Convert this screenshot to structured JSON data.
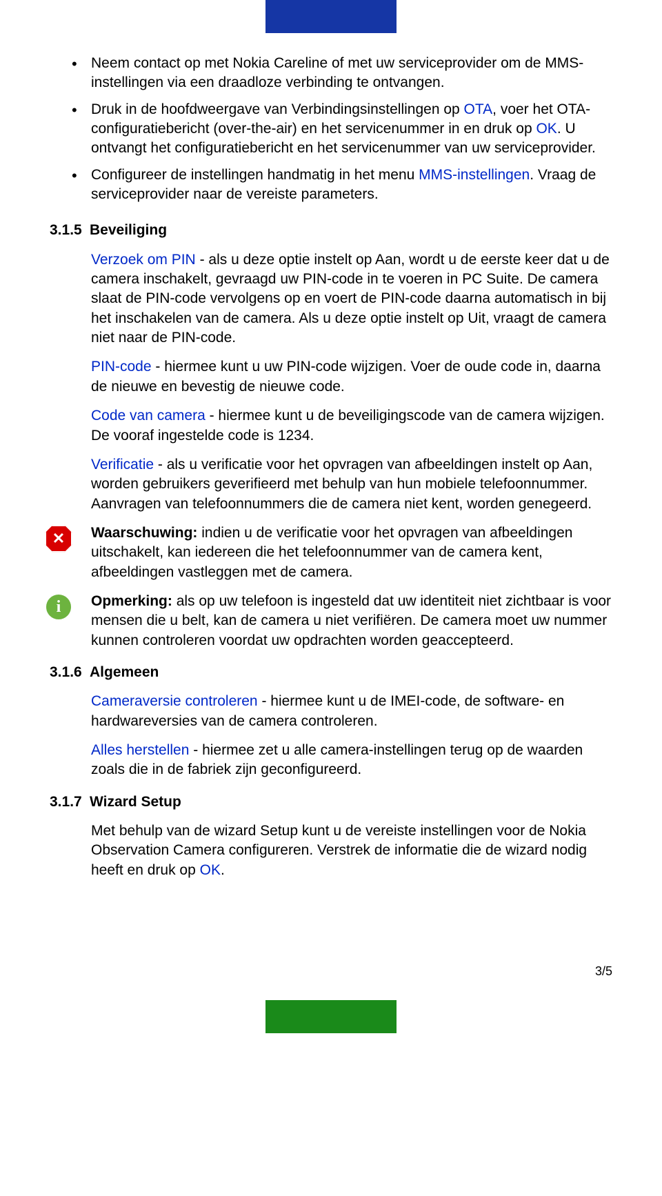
{
  "bullets": [
    {
      "text_before": "Neem contact op met Nokia Careline of met uw serviceprovider om de MMS-instellingen via een draadloze verbinding te ontvangen."
    },
    {
      "text_before": "Druk in de hoofdweergave van Verbindingsinstellingen op ",
      "blue1": "OTA",
      "mid1": ", voer het OTA-configuratiebericht (over-the-air) en het servicenummer in en druk op ",
      "blue2": "OK",
      "mid2": ". U ontvangt het configuratiebericht en het servicenummer van uw serviceprovider."
    },
    {
      "text_before": "Configureer de instellingen handmatig in het menu ",
      "blue1": "MMS-instellingen",
      "mid1": ". Vraag de serviceprovider naar de vereiste parameters."
    }
  ],
  "s315": {
    "num": "3.1.5",
    "title": "Beveiliging",
    "p1_blue": "Verzoek om PIN",
    "p1_rest": " - als u deze optie instelt op Aan, wordt u de eerste keer dat u de camera inschakelt, gevraagd uw PIN-code in te voeren in PC Suite. De camera slaat de PIN-code vervolgens op en voert de PIN-code daarna automatisch in bij het inschakelen van de camera. Als u deze optie instelt op Uit, vraagt de camera niet naar de PIN-code.",
    "p2_blue": "PIN-code",
    "p2_rest": " - hiermee kunt u uw PIN-code wijzigen. Voer de oude code in, daarna de nieuwe en bevestig de nieuwe code.",
    "p3_blue": "Code van camera",
    "p3_rest": " - hiermee kunt u de beveiligingscode van de camera wijzigen. De vooraf ingestelde code is 1234.",
    "p4_blue": "Verificatie",
    "p4_rest": " - als u verificatie voor het opvragen van afbeeldingen instelt op Aan, worden gebruikers geverifieerd met behulp van hun mobiele telefoonnummer. Aanvragen van telefoonnummers die de camera niet kent, worden genegeerd.",
    "warn_label": "Waarschuwing:",
    "warn_text": " indien u de verificatie voor het opvragen van afbeeldingen uitschakelt, kan iedereen die het telefoonnummer van de camera kent, afbeeldingen vastleggen met de camera.",
    "note_label": "Opmerking:",
    "note_text": " als op uw telefoon is ingesteld dat uw identiteit niet zichtbaar is voor mensen die u belt, kan de camera u niet verifiëren. De camera moet uw nummer kunnen controleren voordat uw opdrachten worden geaccepteerd."
  },
  "s316": {
    "num": "3.1.6",
    "title": "Algemeen",
    "p1_blue": "Cameraversie controleren",
    "p1_rest": " - hiermee kunt u de IMEI-code, de software- en hardwareversies van de camera controleren.",
    "p2_blue": "Alles herstellen",
    "p2_rest": " - hiermee zet u alle camera-instellingen terug op de waarden zoals die in de fabriek zijn geconfigureerd."
  },
  "s317": {
    "num": "3.1.7",
    "title": "Wizard Setup",
    "p1_a": "Met behulp van de wizard Setup kunt u de vereiste instellingen voor de Nokia Observation Camera configureren. Verstrek de informatie die de wizard nodig heeft en druk op ",
    "p1_blue": "OK",
    "p1_b": "."
  },
  "page_number": "3/5",
  "info_glyph": "i"
}
